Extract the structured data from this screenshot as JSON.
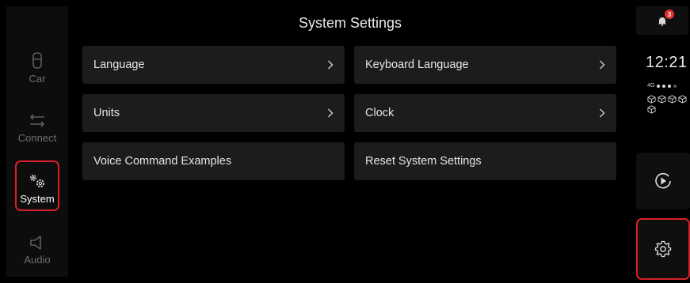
{
  "header": {
    "title": "System Settings"
  },
  "nav": [
    {
      "label": "Car",
      "icon": "car-icon"
    },
    {
      "label": "Connect",
      "icon": "connect-icon"
    },
    {
      "label": "System",
      "icon": "system-gears-icon",
      "active": true
    },
    {
      "label": "Audio",
      "icon": "speaker-icon"
    }
  ],
  "tiles": {
    "language": "Language",
    "keyboard_language": "Keyboard Language",
    "units": "Units",
    "clock": "Clock",
    "voice_command_examples": "Voice Command Examples",
    "reset_system_settings": "Reset System Settings"
  },
  "status": {
    "notifications_count": "3",
    "time": "12:21",
    "network": "4G"
  },
  "colors": {
    "accent_highlight": "#d8202a",
    "tile_bg": "#1c1c1c",
    "background": "#000000"
  }
}
